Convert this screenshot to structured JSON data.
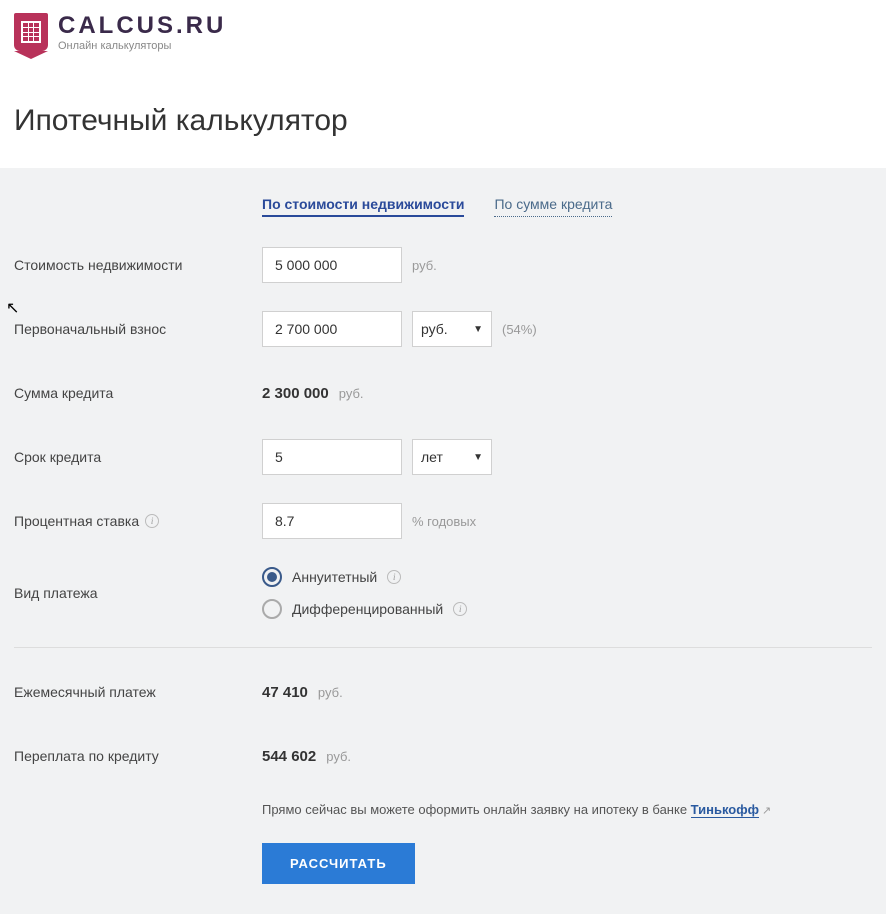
{
  "brand": {
    "name": "CALCUS.RU",
    "tagline": "Онлайн калькуляторы"
  },
  "page": {
    "title": "Ипотечный калькулятор"
  },
  "tabs": {
    "by_property": "По стоимости недвижимости",
    "by_loan": "По сумме кредита"
  },
  "labels": {
    "property_value": "Стоимость недвижимости",
    "down_payment": "Первоначальный взнос",
    "loan_amount": "Сумма кредита",
    "term": "Срок кредита",
    "rate": "Процентная ставка",
    "payment_type": "Вид платежа",
    "monthly": "Ежемесячный платеж",
    "overpay": "Переплата по кредиту"
  },
  "values": {
    "property_value": "5 000 000",
    "down_payment": "2 700 000",
    "down_payment_pct": "(54%)",
    "loan_amount": "2 300 000",
    "term": "5",
    "rate": "8.7",
    "monthly": "47 410",
    "overpay": "544 602"
  },
  "units": {
    "rub": "руб.",
    "years": "лет",
    "pct_annual": "% годовых"
  },
  "select_options": {
    "down_payment_unit": "руб.",
    "term_unit": "лет"
  },
  "radio": {
    "annuity": "Аннуитетный",
    "differentiated": "Дифференцированный"
  },
  "promo": {
    "text": "Прямо сейчас вы можете оформить онлайн заявку на ипотеку в банке ",
    "link": "Тинькофф"
  },
  "buttons": {
    "calculate": "РАССЧИТАТЬ"
  }
}
